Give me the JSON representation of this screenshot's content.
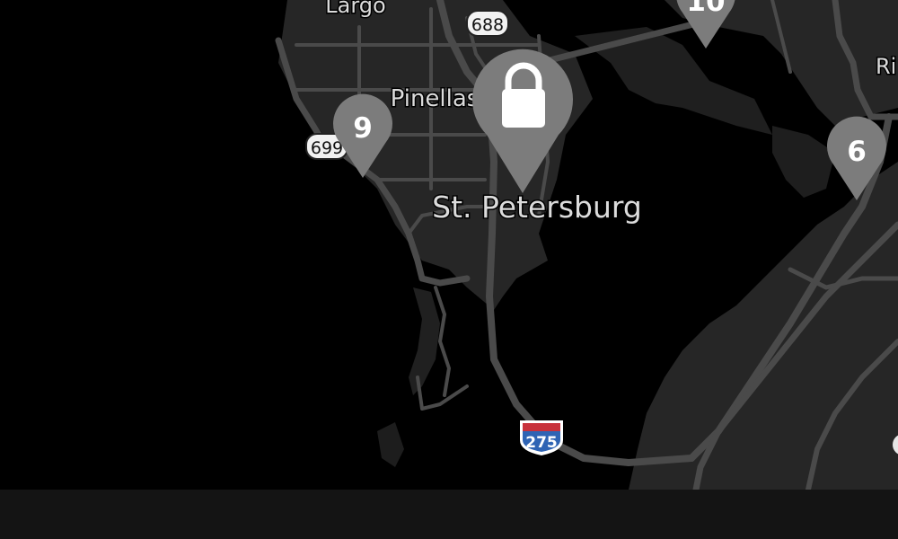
{
  "map": {
    "city_labels": {
      "largo": "Largo",
      "pinellas": "Pinellas",
      "st_petersburg": "St. Petersburg",
      "riverview_partial": "Ri"
    },
    "road_shields": {
      "route_688": "688",
      "route_699": "699",
      "interstate_275": "275"
    },
    "markers": {
      "locked_marker_icon": "lock",
      "marker_9": "9",
      "marker_10": "10",
      "marker_6": "6"
    },
    "colors": {
      "water": "#000000",
      "land": "#262626",
      "land_dark": "#1c1c1c",
      "road": "#4a4a4a",
      "marker": "#7c7c7c",
      "label": "#dcdcdc",
      "bottom_bar": "#141414"
    }
  }
}
